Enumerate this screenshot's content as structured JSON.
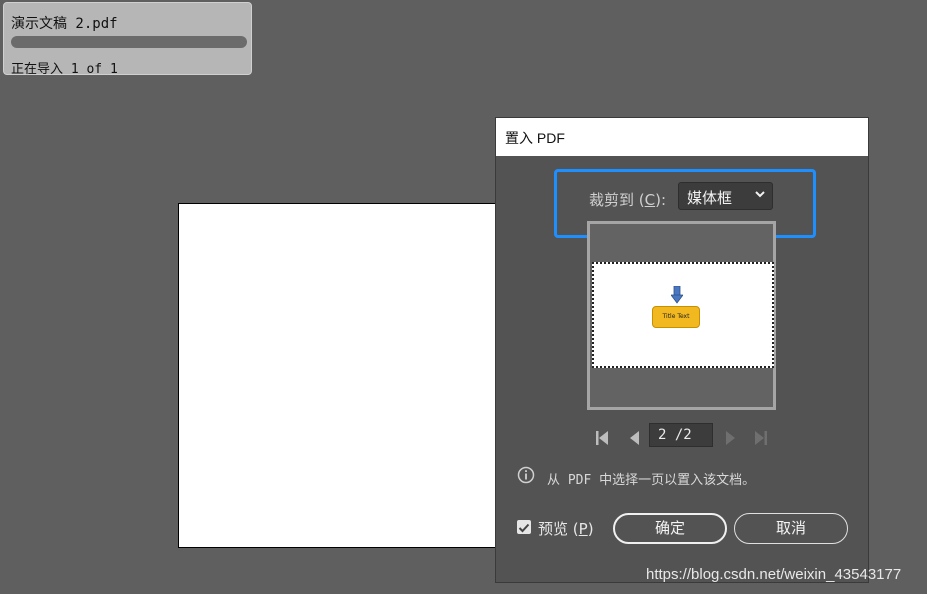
{
  "import_panel": {
    "filename": "演示文稿 2.pdf",
    "status": "正在导入 1 of 1",
    "progress": 1.0
  },
  "dialog": {
    "title": "置入 PDF",
    "crop_label": "裁剪到",
    "crop_hotkey_open": "(",
    "crop_hotkey": "C",
    "crop_hotkey_close": "):",
    "crop_value": "媒体框",
    "preview_button_text": "Title Text",
    "page_value": "2 /2",
    "info_text": "从 PDF 中选择一页以置入该文档。",
    "preview_label": "预览",
    "preview_hotkey_open": "(",
    "preview_hotkey": "P",
    "preview_hotkey_close": ")",
    "preview_checked": true,
    "ok_label": "确定",
    "cancel_label": "取消",
    "icons": {
      "first": "first-page-icon",
      "prev": "prev-page-icon",
      "next": "next-page-icon",
      "last": "last-page-icon",
      "info": "info-icon",
      "chevron": "chevron-down-icon"
    }
  },
  "watermark": "https://blog.csdn.net/weixin_43543177",
  "colors": {
    "background": "#5f5f5f",
    "dialog": "#535353",
    "highlight": "#1e8fff",
    "preview_button": "#f1b820"
  }
}
